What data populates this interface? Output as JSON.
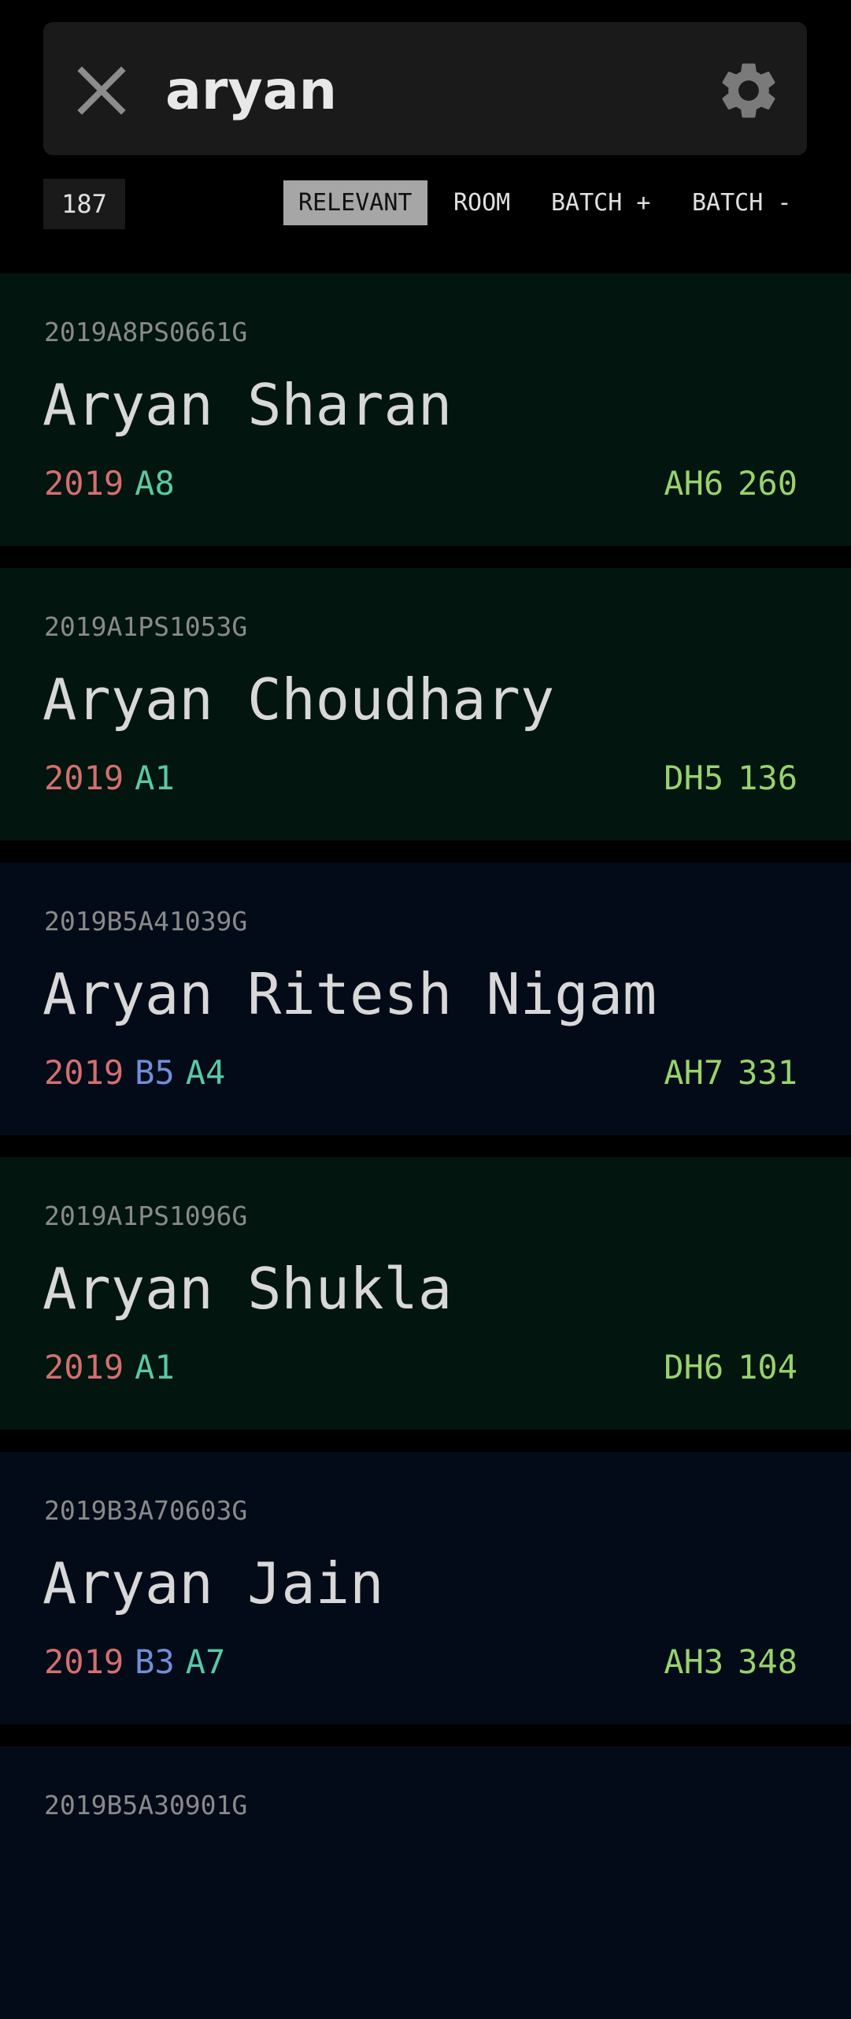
{
  "search": {
    "query": "aryan",
    "close_icon": "close-icon",
    "settings_icon": "gear-icon"
  },
  "results_count": "187",
  "sort_tabs": [
    {
      "label": "RELEVANT",
      "active": true
    },
    {
      "label": "ROOM",
      "active": false
    },
    {
      "label": "BATCH +",
      "active": false
    },
    {
      "label": "BATCH -",
      "active": false
    }
  ],
  "colors": {
    "background": "#000000",
    "search_bar": "#1a1a1a",
    "active_tab": "#a6a6a6",
    "card_green": "#03150f",
    "card_blue": "#030b18",
    "year": "#d46f6f",
    "dual_branch": "#6f8fd8",
    "program": "#59c9a5",
    "room": "#97d36d"
  },
  "results": [
    {
      "id": "2019A8PS0661G",
      "name": "Aryan Sharan",
      "year": "2019",
      "dual": "",
      "program": "A8",
      "hostel": "AH6",
      "room": "260",
      "theme": "green"
    },
    {
      "id": "2019A1PS1053G",
      "name": "Aryan Choudhary",
      "year": "2019",
      "dual": "",
      "program": "A1",
      "hostel": "DH5",
      "room": "136",
      "theme": "green"
    },
    {
      "id": "2019B5A41039G",
      "name": "Aryan Ritesh Nigam",
      "year": "2019",
      "dual": "B5",
      "program": "A4",
      "hostel": "AH7",
      "room": "331",
      "theme": "blue"
    },
    {
      "id": "2019A1PS1096G",
      "name": "Aryan Shukla",
      "year": "2019",
      "dual": "",
      "program": "A1",
      "hostel": "DH6",
      "room": "104",
      "theme": "green"
    },
    {
      "id": "2019B3A70603G",
      "name": "Aryan Jain",
      "year": "2019",
      "dual": "B3",
      "program": "A7",
      "hostel": "AH3",
      "room": "348",
      "theme": "blue"
    },
    {
      "id": "2019B5A30901G",
      "name": "",
      "year": "",
      "dual": "",
      "program": "",
      "hostel": "",
      "room": "",
      "theme": "blue"
    }
  ]
}
